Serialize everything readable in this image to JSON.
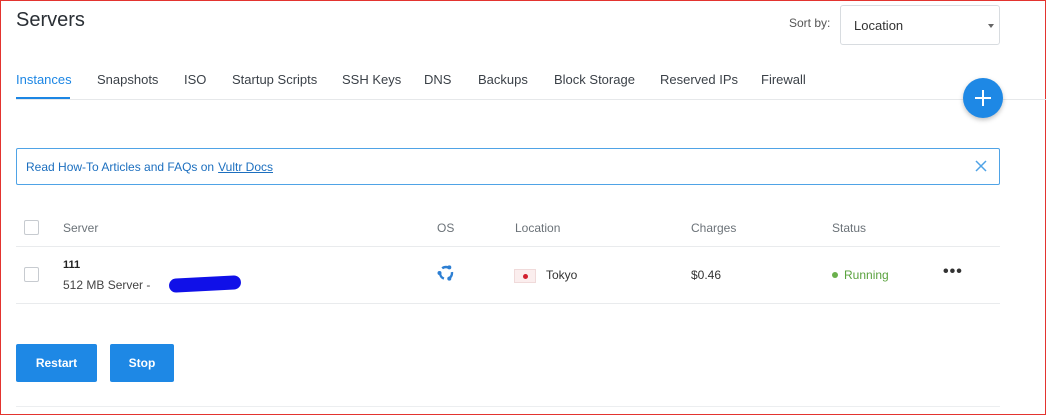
{
  "page": {
    "title": "Servers"
  },
  "sort": {
    "label": "Sort by:",
    "value": "Location"
  },
  "tabs": [
    {
      "label": "Instances",
      "active": true
    },
    {
      "label": "Snapshots"
    },
    {
      "label": "ISO"
    },
    {
      "label": "Startup Scripts"
    },
    {
      "label": "SSH Keys"
    },
    {
      "label": "DNS"
    },
    {
      "label": "Backups"
    },
    {
      "label": "Block Storage"
    },
    {
      "label": "Reserved IPs"
    },
    {
      "label": "Firewall"
    }
  ],
  "notice": {
    "text": "Read How-To Articles and FAQs on",
    "link": "Vultr Docs"
  },
  "table": {
    "columns": [
      "Server",
      "OS",
      "Location",
      "Charges",
      "Status"
    ],
    "rows": [
      {
        "name": "111",
        "description": "512 MB Server -",
        "os_icon": "ubuntu-icon",
        "location": "Tokyo",
        "flag": "japan-flag",
        "charges": "$0.46",
        "status": "Running"
      }
    ]
  },
  "actions": {
    "restart": "Restart",
    "stop": "Stop"
  },
  "colors": {
    "accent": "#1e88e5",
    "running": "#5aa23e",
    "frame": "#e3342f",
    "redaction": "#1010e8"
  }
}
